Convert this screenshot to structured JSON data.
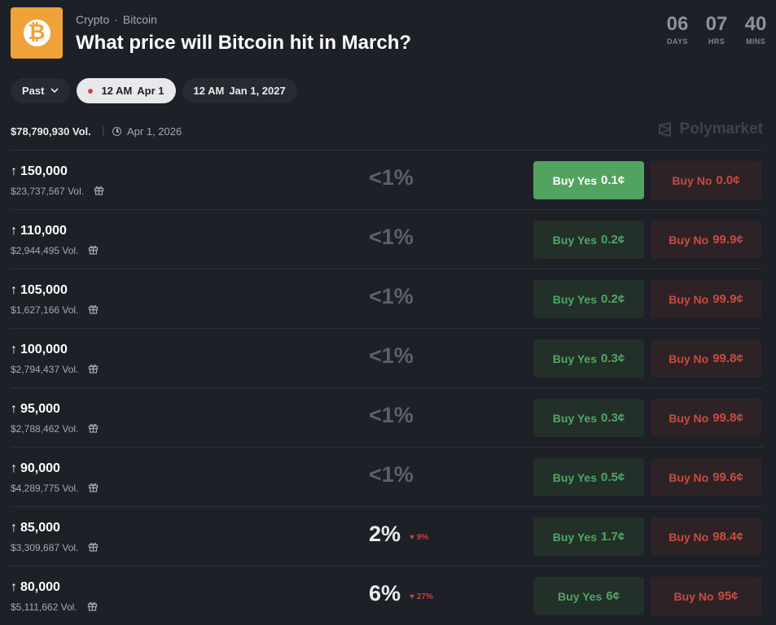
{
  "header": {
    "breadcrumb": [
      "Crypto",
      "Bitcoin"
    ],
    "title": "What price will Bitcoin hit in March?",
    "countdown": [
      {
        "value": "06",
        "unit": "DAYS"
      },
      {
        "value": "07",
        "unit": "HRS"
      },
      {
        "value": "40",
        "unit": "MINS"
      }
    ]
  },
  "date_pills": {
    "past": "Past",
    "selected": {
      "time": "12 AM",
      "date": "Apr 1"
    },
    "other": {
      "time": "12 AM",
      "date": "Jan 1, 2027"
    }
  },
  "meta": {
    "volume": "$78,790,930 Vol.",
    "end_date": "Apr 1, 2026",
    "brand": "Polymarket"
  },
  "colors": {
    "yes": "#4ea864",
    "no": "#c84b42",
    "logo": "#f0a23a"
  },
  "markets": [
    {
      "strike": "150,000",
      "volume": "$23,737,567 Vol.",
      "probability": "<1%",
      "change": "",
      "yes_label": "Buy Yes",
      "yes_price": "0.1¢",
      "no_label": "Buy No",
      "no_price": "0.0¢"
    },
    {
      "strike": "110,000",
      "volume": "$2,944,495 Vol.",
      "probability": "<1%",
      "change": "",
      "yes_label": "Buy Yes",
      "yes_price": "0.2¢",
      "no_label": "Buy No",
      "no_price": "99.9¢"
    },
    {
      "strike": "105,000",
      "volume": "$1,627,166 Vol.",
      "probability": "<1%",
      "change": "",
      "yes_label": "Buy Yes",
      "yes_price": "0.2¢",
      "no_label": "Buy No",
      "no_price": "99.9¢"
    },
    {
      "strike": "100,000",
      "volume": "$2,794,437 Vol.",
      "probability": "<1%",
      "change": "",
      "yes_label": "Buy Yes",
      "yes_price": "0.3¢",
      "no_label": "Buy No",
      "no_price": "99.8¢"
    },
    {
      "strike": "95,000",
      "volume": "$2,788,462 Vol.",
      "probability": "<1%",
      "change": "",
      "yes_label": "Buy Yes",
      "yes_price": "0.3¢",
      "no_label": "Buy No",
      "no_price": "99.8¢"
    },
    {
      "strike": "90,000",
      "volume": "$4,289,775 Vol.",
      "probability": "<1%",
      "change": "",
      "yes_label": "Buy Yes",
      "yes_price": "0.5¢",
      "no_label": "Buy No",
      "no_price": "99.6¢"
    },
    {
      "strike": "85,000",
      "volume": "$3,309,687 Vol.",
      "probability": "2%",
      "change": "9%",
      "yes_label": "Buy Yes",
      "yes_price": "1.7¢",
      "no_label": "Buy No",
      "no_price": "98.4¢"
    },
    {
      "strike": "80,000",
      "volume": "$5,111,662 Vol.",
      "probability": "6%",
      "change": "27%",
      "yes_label": "Buy Yes",
      "yes_price": "6¢",
      "no_label": "Buy No",
      "no_price": "95¢"
    }
  ]
}
